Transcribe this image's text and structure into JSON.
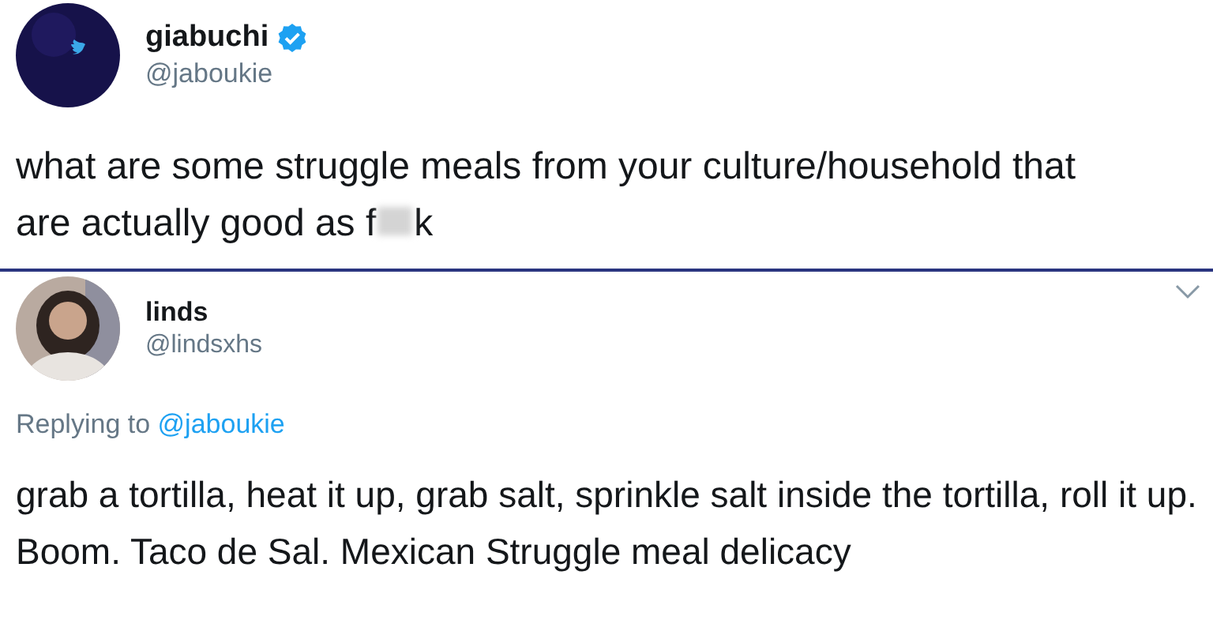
{
  "original_tweet": {
    "name": "giabuchi",
    "verified": true,
    "handle": "@jaboukie",
    "text": "what are some struggle meals from your culture/household that are actually good as",
    "censored_word": {
      "visible_start": "f",
      "visible_end": "k"
    }
  },
  "reply": {
    "name": "linds",
    "handle": "@lindsxhs",
    "replying_label": "Replying to",
    "replying_handle": "@jaboukie",
    "text": "grab a tortilla, heat it up, grab salt, sprinkle salt inside the tortilla, roll it up. Boom. Taco de Sal. Mexican Struggle meal delicacy"
  }
}
